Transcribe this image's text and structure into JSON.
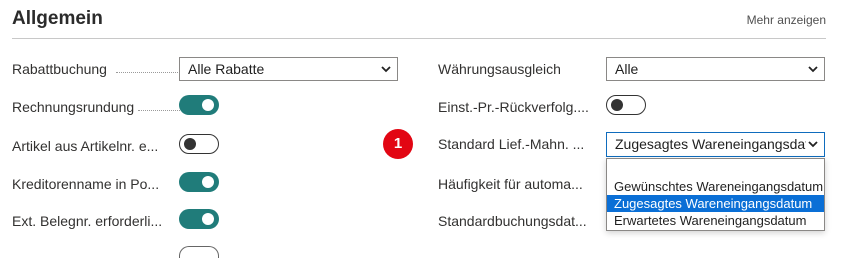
{
  "section": {
    "title": "Allgemein",
    "more_link": "Mehr anzeigen"
  },
  "left_fields": [
    {
      "label": "Rabattbuchung",
      "type": "select",
      "value": "Alle Rabatte"
    },
    {
      "label": "Rechnungsrundung",
      "type": "toggle",
      "on": true
    },
    {
      "label": "Artikel aus Artikelnr. e...",
      "type": "toggle",
      "on": false
    },
    {
      "label": "Kreditorenname in Po...",
      "type": "toggle",
      "on": true
    },
    {
      "label": "Ext. Belegnr. erforderli...",
      "type": "toggle",
      "on": true
    }
  ],
  "right_fields": [
    {
      "label": "Währungsausgleich",
      "type": "select",
      "value": "Alle"
    },
    {
      "label": "Einst.-Pr.-Rückverfolg....",
      "type": "toggle",
      "on": false
    },
    {
      "label": "Standard Lief.-Mahn. ...",
      "type": "select",
      "value": "Zugesagtes Wareneingangsdat"
    },
    {
      "label": "Häufigkeit für automa...",
      "type": "text"
    },
    {
      "label": "Standardbuchungsdat...",
      "type": "text"
    }
  ],
  "callout": {
    "number": "1",
    "color": "#e20613"
  },
  "dropdown": {
    "options": [
      "Gewünschtes Wareneingangsdatum",
      "Zugesagtes Wareneingangsdatum",
      "Erwartetes Wareneingangsdatum"
    ],
    "selected": "Zugesagtes Wareneingangsdatum"
  },
  "colors": {
    "toggle_on": "#207c7a",
    "accent": "#0f6cbd",
    "selected_option": "#0a6fd6"
  }
}
